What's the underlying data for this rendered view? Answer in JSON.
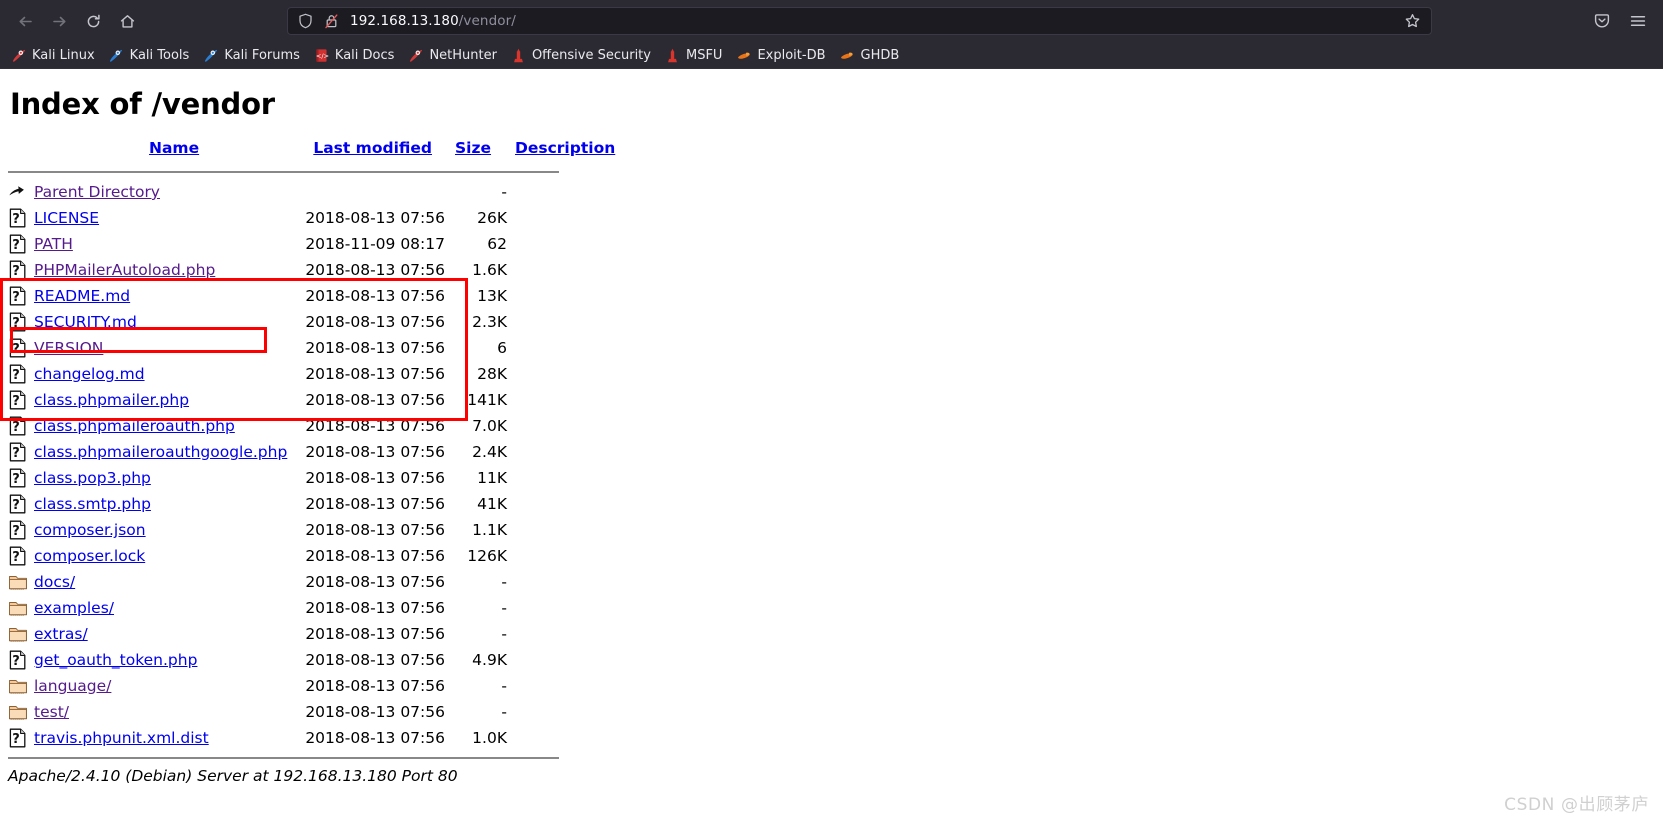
{
  "browser": {
    "nav": {
      "back_label": "Back",
      "forward_label": "Forward",
      "reload_label": "Reload",
      "home_label": "Home"
    },
    "urlbar": {
      "host": "192.168.13.180",
      "path": "/vendor/",
      "shield_icon": "shield-icon",
      "lock_icon": "lock-crossed-icon",
      "star_icon": "bookmark-star-icon"
    },
    "right_icons": {
      "pocket_label": "Save to Pocket",
      "menu_label": "Open application menu"
    },
    "bookmarks": [
      {
        "label": "Kali Linux",
        "icon": "kali-dragon-red-icon"
      },
      {
        "label": "Kali Tools",
        "icon": "kali-dragon-blue-icon"
      },
      {
        "label": "Kali Forums",
        "icon": "kali-dragon-blue-icon"
      },
      {
        "label": "Kali Docs",
        "icon": "book-red-icon"
      },
      {
        "label": "NetHunter",
        "icon": "kali-dragon-red-icon"
      },
      {
        "label": "Offensive Security",
        "icon": "exploit-tower-icon"
      },
      {
        "label": "MSFU",
        "icon": "exploit-tower-icon"
      },
      {
        "label": "Exploit-DB",
        "icon": "exploit-spark-icon"
      },
      {
        "label": "GHDB",
        "icon": "exploit-spark-icon"
      }
    ]
  },
  "page": {
    "title": "Index of /vendor",
    "columns": {
      "name": "Name",
      "last_modified": "Last modified",
      "size": "Size",
      "description": "Description"
    },
    "rows": [
      {
        "icon": "parent-directory-icon",
        "name": "Parent Directory",
        "visited": true,
        "date": "",
        "size": "-",
        "description": ""
      },
      {
        "icon": "unknown-file-icon",
        "name": "LICENSE",
        "visited": false,
        "date": "2018-08-13 07:56",
        "size": "26K",
        "description": ""
      },
      {
        "icon": "unknown-file-icon",
        "name": "PATH",
        "visited": true,
        "date": "2018-11-09 08:17",
        "size": "62",
        "description": ""
      },
      {
        "icon": "unknown-file-icon",
        "name": "PHPMailerAutoload.php",
        "visited": true,
        "date": "2018-08-13 07:56",
        "size": "1.6K",
        "description": ""
      },
      {
        "icon": "unknown-file-icon",
        "name": "README.md",
        "visited": false,
        "date": "2018-08-13 07:56",
        "size": "13K",
        "description": ""
      },
      {
        "icon": "unknown-file-icon",
        "name": "SECURITY.md",
        "visited": false,
        "date": "2018-08-13 07:56",
        "size": "2.3K",
        "description": ""
      },
      {
        "icon": "unknown-file-icon",
        "name": "VERSION",
        "visited": true,
        "date": "2018-08-13 07:56",
        "size": "6",
        "description": ""
      },
      {
        "icon": "unknown-file-icon",
        "name": "changelog.md",
        "visited": false,
        "date": "2018-08-13 07:56",
        "size": "28K",
        "description": ""
      },
      {
        "icon": "unknown-file-icon",
        "name": "class.phpmailer.php",
        "visited": false,
        "date": "2018-08-13 07:56",
        "size": "141K",
        "description": ""
      },
      {
        "icon": "unknown-file-icon",
        "name": "class.phpmaileroauth.php",
        "visited": false,
        "date": "2018-08-13 07:56",
        "size": "7.0K",
        "description": ""
      },
      {
        "icon": "unknown-file-icon",
        "name": "class.phpmaileroauthgoogle.php",
        "visited": false,
        "date": "2018-08-13 07:56",
        "size": "2.4K",
        "description": ""
      },
      {
        "icon": "unknown-file-icon",
        "name": "class.pop3.php",
        "visited": false,
        "date": "2018-08-13 07:56",
        "size": "11K",
        "description": ""
      },
      {
        "icon": "unknown-file-icon",
        "name": "class.smtp.php",
        "visited": false,
        "date": "2018-08-13 07:56",
        "size": "41K",
        "description": ""
      },
      {
        "icon": "unknown-file-icon",
        "name": "composer.json",
        "visited": false,
        "date": "2018-08-13 07:56",
        "size": "1.1K",
        "description": ""
      },
      {
        "icon": "unknown-file-icon",
        "name": "composer.lock",
        "visited": false,
        "date": "2018-08-13 07:56",
        "size": "126K",
        "description": ""
      },
      {
        "icon": "folder-icon",
        "name": "docs/",
        "visited": false,
        "date": "2018-08-13 07:56",
        "size": "-",
        "description": ""
      },
      {
        "icon": "folder-icon",
        "name": "examples/",
        "visited": false,
        "date": "2018-08-13 07:56",
        "size": "-",
        "description": ""
      },
      {
        "icon": "folder-icon",
        "name": "extras/",
        "visited": false,
        "date": "2018-08-13 07:56",
        "size": "-",
        "description": ""
      },
      {
        "icon": "unknown-file-icon",
        "name": "get_oauth_token.php",
        "visited": false,
        "date": "2018-08-13 07:56",
        "size": "4.9K",
        "description": ""
      },
      {
        "icon": "folder-icon",
        "name": "language/",
        "visited": true,
        "date": "2018-08-13 07:56",
        "size": "-",
        "description": ""
      },
      {
        "icon": "folder-icon",
        "name": "test/",
        "visited": true,
        "date": "2018-08-13 07:56",
        "size": "-",
        "description": ""
      },
      {
        "icon": "unknown-file-icon",
        "name": "travis.phpunit.xml.dist",
        "visited": false,
        "date": "2018-08-13 07:56",
        "size": "1.0K",
        "description": ""
      }
    ],
    "server_signature": "Apache/2.4.10 (Debian) Server at 192.168.13.180 Port 80"
  },
  "annotations": {
    "highlight_color": "#ff0000",
    "group_box_label": "highlighted-file-group",
    "single_box_label": "highlighted-phpmailerautoload"
  },
  "watermark": "CSDN @出顾茅庐"
}
